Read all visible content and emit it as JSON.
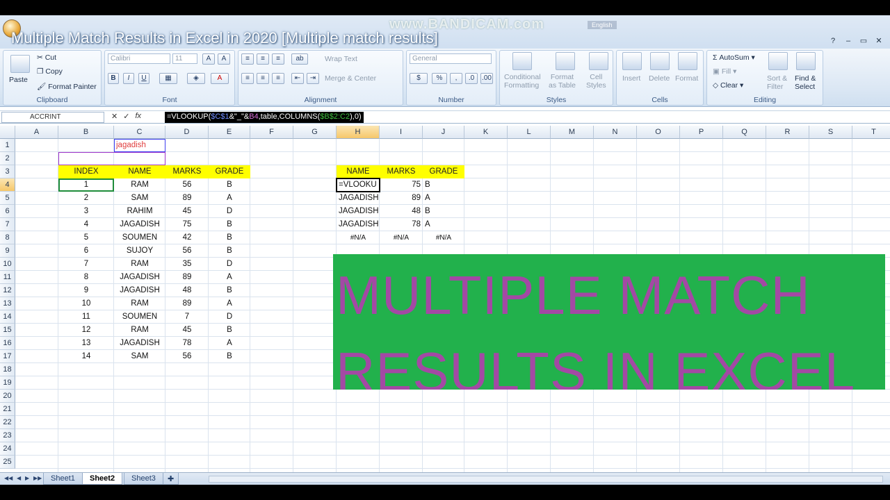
{
  "window": {
    "title": "Multiple Match Results in Excel in 2020 [Multiple match results]",
    "watermark": "www.BANDICAM.com",
    "language": "English"
  },
  "ribbon": {
    "clipboard": {
      "label": "Clipboard",
      "paste": "Paste",
      "cut": "Cut",
      "copy": "Copy",
      "format_painter": "Format Painter"
    },
    "font": {
      "label": "Font",
      "font_name": "Calibri",
      "font_size": "11",
      "bold": "B",
      "italic": "I",
      "underline": "U"
    },
    "alignment": {
      "label": "Alignment",
      "wrap_text": "Wrap Text",
      "merge_center": "Merge & Center"
    },
    "number": {
      "label": "Number",
      "format": "General",
      "currency": "$",
      "percent": "%"
    },
    "styles": {
      "label": "Styles",
      "conditional_1": "Conditional",
      "conditional_2": "Formatting",
      "format_table_1": "Format",
      "format_table_2": "as Table",
      "cell_styles_1": "Cell",
      "cell_styles_2": "Styles"
    },
    "cells": {
      "label": "Cells",
      "insert": "Insert",
      "delete": "Delete",
      "format": "Format"
    },
    "editing": {
      "label": "Editing",
      "autosum": "AutoSum",
      "fill": "Fill",
      "clear": "Clear",
      "sort_1": "Sort &",
      "sort_2": "Filter",
      "find_1": "Find &",
      "find_2": "Select"
    }
  },
  "formula_bar": {
    "name_box": "ACCRINT",
    "fx": "fx",
    "formula_parts": [
      "=VLOOKUP(",
      "$C$1",
      "&\"_\"&",
      "B4",
      ",table,COLUMNS(",
      "$B$2:C2",
      "),0)"
    ]
  },
  "columns": [
    "A",
    "B",
    "C",
    "D",
    "E",
    "F",
    "G",
    "H",
    "I",
    "J",
    "K",
    "L",
    "M",
    "N",
    "O",
    "P",
    "Q",
    "R",
    "S",
    "T"
  ],
  "rows": [
    "1",
    "2",
    "3",
    "4",
    "5",
    "6",
    "7",
    "8",
    "9",
    "10",
    "11",
    "12",
    "13",
    "14",
    "15",
    "16",
    "17",
    "18",
    "19",
    "20",
    "21",
    "22",
    "23",
    "24",
    "25"
  ],
  "sheet": {
    "c1": "jagadish",
    "left_headers": [
      "INDEX",
      "NAME",
      "MARKS",
      "GRADE"
    ],
    "left_rows": [
      [
        "1",
        "RAM",
        "56",
        "B"
      ],
      [
        "2",
        "SAM",
        "89",
        "A"
      ],
      [
        "3",
        "RAHIM",
        "45",
        "D"
      ],
      [
        "4",
        "JAGADISH",
        "75",
        "B"
      ],
      [
        "5",
        "SOUMEN",
        "42",
        "B"
      ],
      [
        "6",
        "SUJOY",
        "56",
        "B"
      ],
      [
        "7",
        "RAM",
        "35",
        "D"
      ],
      [
        "8",
        "JAGADISH",
        "89",
        "A"
      ],
      [
        "9",
        "JAGADISH",
        "48",
        "B"
      ],
      [
        "10",
        "RAM",
        "89",
        "A"
      ],
      [
        "11",
        "SOUMEN",
        "7",
        "D"
      ],
      [
        "12",
        "RAM",
        "45",
        "B"
      ],
      [
        "13",
        "JAGADISH",
        "78",
        "A"
      ],
      [
        "14",
        "SAM",
        "56",
        "B"
      ]
    ],
    "right_headers": [
      "NAME",
      "MARKS",
      "GRADE"
    ],
    "right_rows": [
      [
        "=VLOOKU",
        "75",
        "B"
      ],
      [
        "JAGADISH",
        "89",
        "A"
      ],
      [
        "JAGADISH",
        "48",
        "B"
      ],
      [
        "JAGADISH",
        "78",
        "A"
      ]
    ],
    "partial_row_8": [
      "#N/A",
      "#N/A",
      "#N/A"
    ]
  },
  "banner": {
    "line1": "MULTIPLE MATCH",
    "line2": "RESULTS IN EXCEL",
    "background": "#22b14c",
    "text_color": "#a349a4"
  },
  "tabs": [
    "Sheet1",
    "Sheet2",
    "Sheet3"
  ],
  "colors": {
    "header_yellow": "#ffff00",
    "c1_text": "#e03c3c"
  }
}
